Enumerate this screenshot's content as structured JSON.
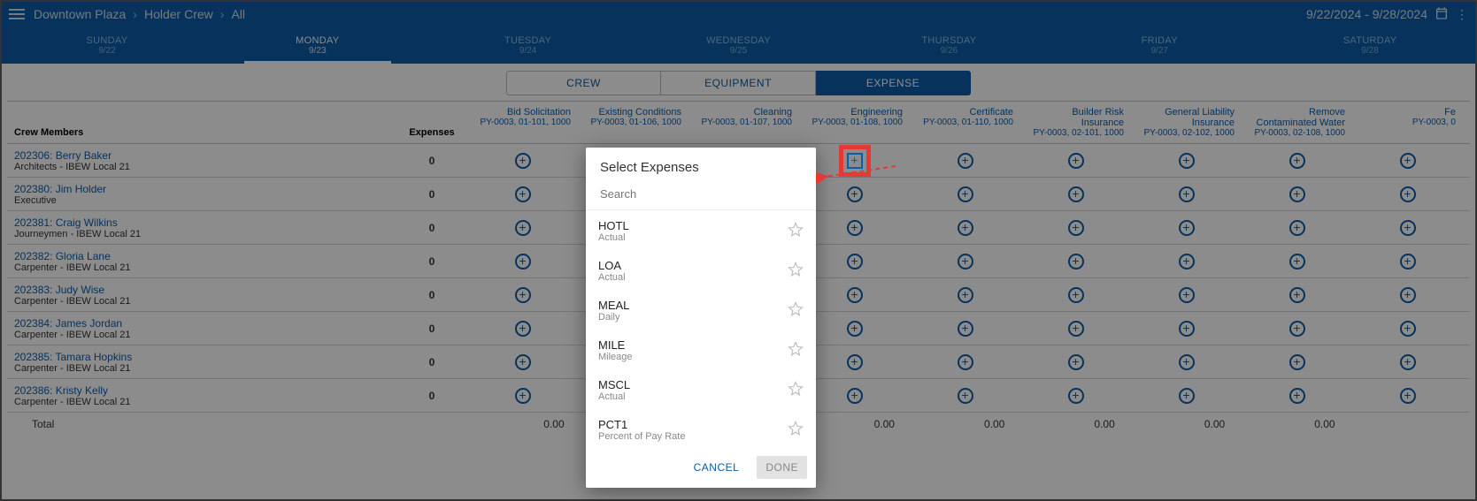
{
  "header": {
    "breadcrumb": [
      "Downtown Plaza",
      "Holder Crew",
      "All"
    ],
    "date_range": "9/22/2024 - 9/28/2024"
  },
  "week": {
    "days": [
      {
        "name": "SUNDAY",
        "date": "9/22",
        "active": false
      },
      {
        "name": "MONDAY",
        "date": "9/23",
        "active": true
      },
      {
        "name": "TUESDAY",
        "date": "9/24",
        "active": false
      },
      {
        "name": "WEDNESDAY",
        "date": "9/25",
        "active": false
      },
      {
        "name": "THURSDAY",
        "date": "9/26",
        "active": false
      },
      {
        "name": "FRIDAY",
        "date": "9/27",
        "active": false
      },
      {
        "name": "SATURDAY",
        "date": "9/28",
        "active": false
      }
    ]
  },
  "subtabs": [
    {
      "label": "CREW",
      "active": false
    },
    {
      "label": "EQUIPMENT",
      "active": false
    },
    {
      "label": "EXPENSE",
      "active": true
    }
  ],
  "grid": {
    "headers": {
      "name": "Crew Members",
      "expenses": "Expenses"
    },
    "jobs": [
      {
        "name": "Bid Solicitation",
        "code": "PY-0003, 01-101, 1000"
      },
      {
        "name": "Existing Conditions",
        "code": "PY-0003, 01-106, 1000"
      },
      {
        "name": "Cleaning",
        "code": "PY-0003, 01-107, 1000"
      },
      {
        "name": "Engineering",
        "code": "PY-0003, 01-108, 1000"
      },
      {
        "name": "Certificate",
        "code": "PY-0003, 01-110, 1000"
      },
      {
        "name": "Builder Risk Insurance",
        "code": "PY-0003, 02-101, 1000"
      },
      {
        "name": "General Liability Insurance",
        "code": "PY-0003, 02-102, 1000"
      },
      {
        "name": "Remove Contaminated Water",
        "code": "PY-0003, 02-108, 1000"
      },
      {
        "name": "Fe",
        "code": "PY-0003, 0"
      }
    ],
    "rows": [
      {
        "id": "202306",
        "name": "Berry Baker",
        "role": "Architects - IBEW Local 21",
        "exp": "0"
      },
      {
        "id": "202380",
        "name": "Jim Holder",
        "role": "Executive",
        "exp": "0"
      },
      {
        "id": "202381",
        "name": "Craig Wilkins",
        "role": "Journeymen - IBEW Local 21",
        "exp": "0"
      },
      {
        "id": "202382",
        "name": "Gloria Lane",
        "role": "Carpenter - IBEW Local 21",
        "exp": "0"
      },
      {
        "id": "202383",
        "name": "Judy Wise",
        "role": "Carpenter - IBEW Local 21",
        "exp": "0"
      },
      {
        "id": "202384",
        "name": "James Jordan",
        "role": "Carpenter - IBEW Local 21",
        "exp": "0"
      },
      {
        "id": "202385",
        "name": "Tamara Hopkins",
        "role": "Carpenter - IBEW Local 21",
        "exp": "0"
      },
      {
        "id": "202386",
        "name": "Kristy Kelly",
        "role": "Carpenter - IBEW Local 21",
        "exp": "0"
      }
    ],
    "totals": {
      "label": "Total",
      "values": [
        "0.00",
        "0.00",
        "",
        "0.00",
        "0.00",
        "0.00",
        "0.00",
        "0.00",
        ""
      ]
    }
  },
  "dialog": {
    "title": "Select Expenses",
    "search_placeholder": "Search",
    "options": [
      {
        "code": "HOTL",
        "sub": "Actual"
      },
      {
        "code": "LOA",
        "sub": "Actual"
      },
      {
        "code": "MEAL",
        "sub": "Daily"
      },
      {
        "code": "MILE",
        "sub": "Mileage"
      },
      {
        "code": "MSCL",
        "sub": "Actual"
      },
      {
        "code": "PCT1",
        "sub": "Percent of Pay Rate"
      }
    ],
    "cancel": "CANCEL",
    "done": "DONE"
  },
  "annotation": {
    "highlight_cell": {
      "row": 0,
      "job": 3
    }
  }
}
